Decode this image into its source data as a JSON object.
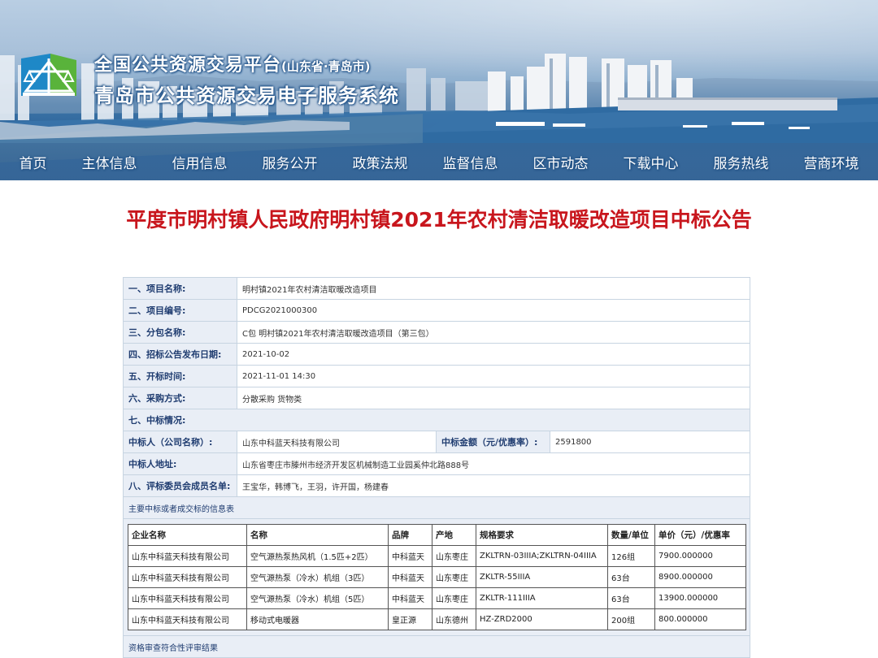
{
  "site": {
    "title_line1": "全国公共资源交易平台",
    "title_region": "(山东省·青岛市)",
    "title_line2": "青岛市公共资源交易电子服务系统"
  },
  "nav": [
    "首页",
    "主体信息",
    "信用信息",
    "服务公开",
    "政策法规",
    "监督信息",
    "区市动态",
    "下载中心",
    "服务热线",
    "营商环境"
  ],
  "notice": {
    "title": "平度市明村镇人民政府明村镇2021年农村清洁取暖改造项目中标公告",
    "fields": {
      "project_name_label": "一、项目名称:",
      "project_name": "明村镇2021年农村清洁取暖改造项目",
      "project_no_label": "二、项目编号:",
      "project_no": "PDCG2021000300",
      "package_label": "三、分包名称:",
      "package": "C包 明村镇2021年农村清洁取暖改造项目（第三包）",
      "publish_date_label": "四、招标公告发布日期:",
      "publish_date": "2021-10-02",
      "open_time_label": "五、开标时间:",
      "open_time": "2021-11-01 14:30",
      "method_label": "六、采购方式:",
      "method": "分散采购 货物类",
      "winner_section_label": "七、中标情况:",
      "winner_label": "中标人（公司名称）:",
      "winner": "山东中科蓝天科技有限公司",
      "amount_label": "中标金额（元/优惠率）:",
      "amount": "2591800",
      "address_label": "中标人地址:",
      "address": "山东省枣庄市滕州市经济开发区机械制造工业园奚仲北路888号",
      "committee_label": "八、评标委员会成员名单:",
      "committee": "王宝华，韩博飞，王羽，许开国，杨建春",
      "items_caption": "主要中标或者成交标的信息表",
      "footer_caption": "资格审查符合性评审结果"
    },
    "items_headers": [
      "企业名称",
      "名称",
      "品牌",
      "产地",
      "规格要求",
      "数量/单位",
      "单价（元）/优惠率"
    ],
    "items": [
      [
        "山东中科蓝天科技有限公司",
        "空气源热泵热风机（1.5匹+2匹）",
        "中科蓝天",
        "山东枣庄",
        "ZKLTRN-03IIIA;ZKLTRN-04IIIA",
        "126组",
        "7900.000000"
      ],
      [
        "山东中科蓝天科技有限公司",
        "空气源热泵（冷水）机组（3匹）",
        "中科蓝天",
        "山东枣庄",
        "ZKLTR-55IIIA",
        "63台",
        "8900.000000"
      ],
      [
        "山东中科蓝天科技有限公司",
        "空气源热泵（冷水）机组（5匹）",
        "中科蓝天",
        "山东枣庄",
        "ZKLTR-111IIIA",
        "63台",
        "13900.000000"
      ],
      [
        "山东中科蓝天科技有限公司",
        "移动式电暖器",
        "皇正源",
        "山东德州",
        "HZ-ZRD2000",
        "200组",
        "800.000000"
      ]
    ]
  },
  "colors": {
    "title_red": "#c8161d",
    "label_blue": "#1f3c70",
    "label_bg": "#e9eef6"
  }
}
